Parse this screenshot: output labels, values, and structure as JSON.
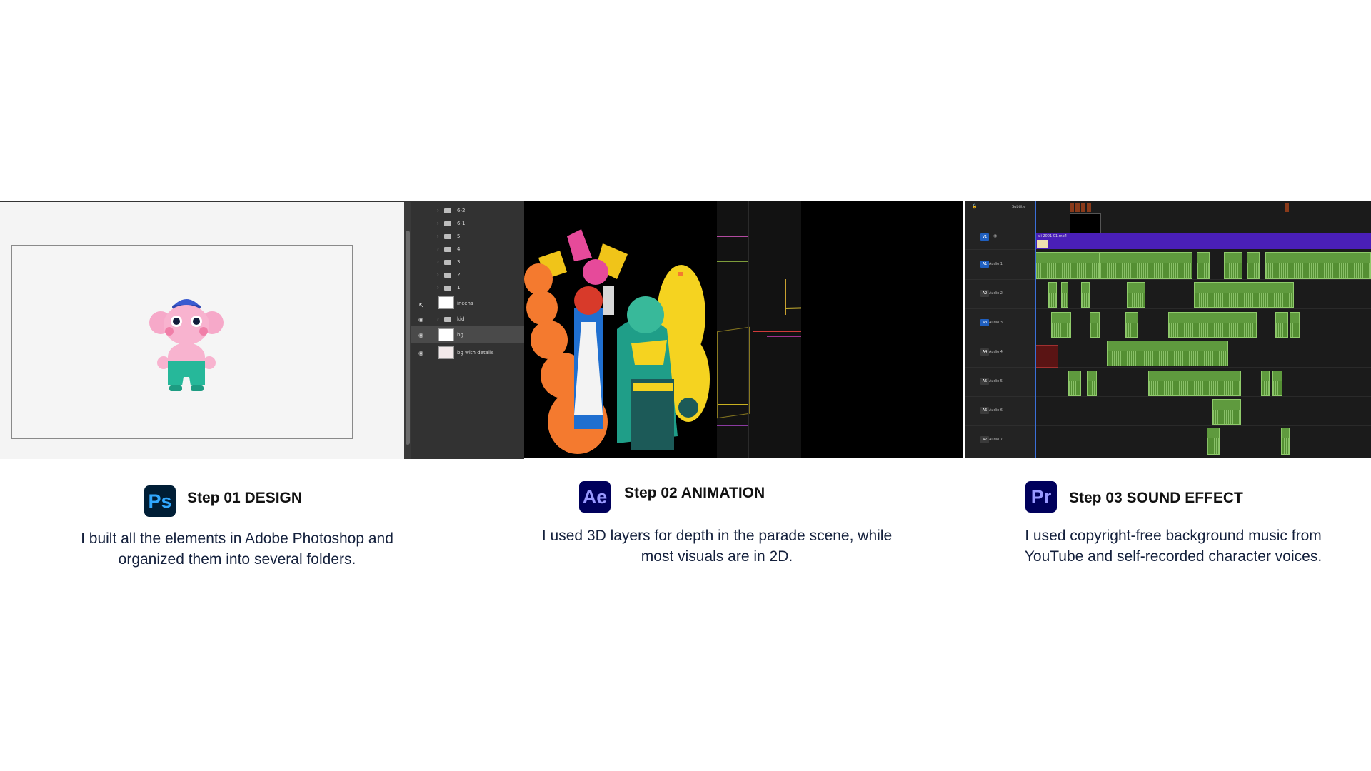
{
  "photoshop_panel": {
    "layers": [
      {
        "name": "6-2",
        "kind": "folder",
        "visible": false
      },
      {
        "name": "6-1",
        "kind": "folder",
        "visible": false
      },
      {
        "name": "5",
        "kind": "folder",
        "visible": false
      },
      {
        "name": "4",
        "kind": "folder",
        "visible": false
      },
      {
        "name": "3",
        "kind": "folder",
        "visible": false
      },
      {
        "name": "2",
        "kind": "folder",
        "visible": false
      },
      {
        "name": "1",
        "kind": "folder",
        "visible": false
      },
      {
        "name": "incens",
        "kind": "image",
        "visible": false
      },
      {
        "name": "kid",
        "kind": "folder",
        "visible": true
      },
      {
        "name": "bg",
        "kind": "image",
        "visible": true,
        "selected": true
      },
      {
        "name": "bg with details",
        "kind": "image",
        "visible": true
      }
    ]
  },
  "premiere_panel": {
    "subtitle_track": "Subtitle",
    "video_track": {
      "id": "V1",
      "clip_name": "ali 2001 01.mp4"
    },
    "audio_tracks": [
      {
        "id": "A1",
        "name": "Audio 1",
        "active": true
      },
      {
        "id": "A2",
        "name": "Audio 2",
        "active": false
      },
      {
        "id": "A3",
        "name": "Audio 3",
        "active": true
      },
      {
        "id": "A4",
        "name": "Audio 4",
        "active": false
      },
      {
        "id": "A5",
        "name": "Audio 5",
        "active": false
      },
      {
        "id": "A6",
        "name": "Audio 6",
        "active": false
      },
      {
        "id": "A7",
        "name": "Audio 7",
        "active": false
      }
    ]
  },
  "steps": [
    {
      "icon_label": "Ps",
      "icon_name": "photoshop-icon",
      "icon_bg": "#001e36",
      "icon_fg": "#31a8ff",
      "title": "Step 01 DESIGN",
      "description_line1": "I built all the elements in Adobe Photoshop and",
      "description_line2": "organized them into several folders."
    },
    {
      "icon_label": "Ae",
      "icon_name": "after-effects-icon",
      "icon_bg": "#00005b",
      "icon_fg": "#9999ff",
      "title": "Step 02 ANIMATION",
      "description_line1": "I used 3D layers for depth in the parade scene, while",
      "description_line2": "most visuals are in 2D."
    },
    {
      "icon_label": "Pr",
      "icon_name": "premiere-pro-icon",
      "icon_bg": "#00005b",
      "icon_fg": "#9999ff",
      "title": "Step 03 SOUND EFFECT",
      "description_line1": "I used copyright-free background music from",
      "description_line2": "YouTube and self-recorded character voices."
    }
  ],
  "colors": {
    "page_bg": "#ffffff",
    "text_dark": "#14203c",
    "premiere_video_clip": "#4a1fb8",
    "premiere_audio_clip": "#5f9a3e"
  }
}
